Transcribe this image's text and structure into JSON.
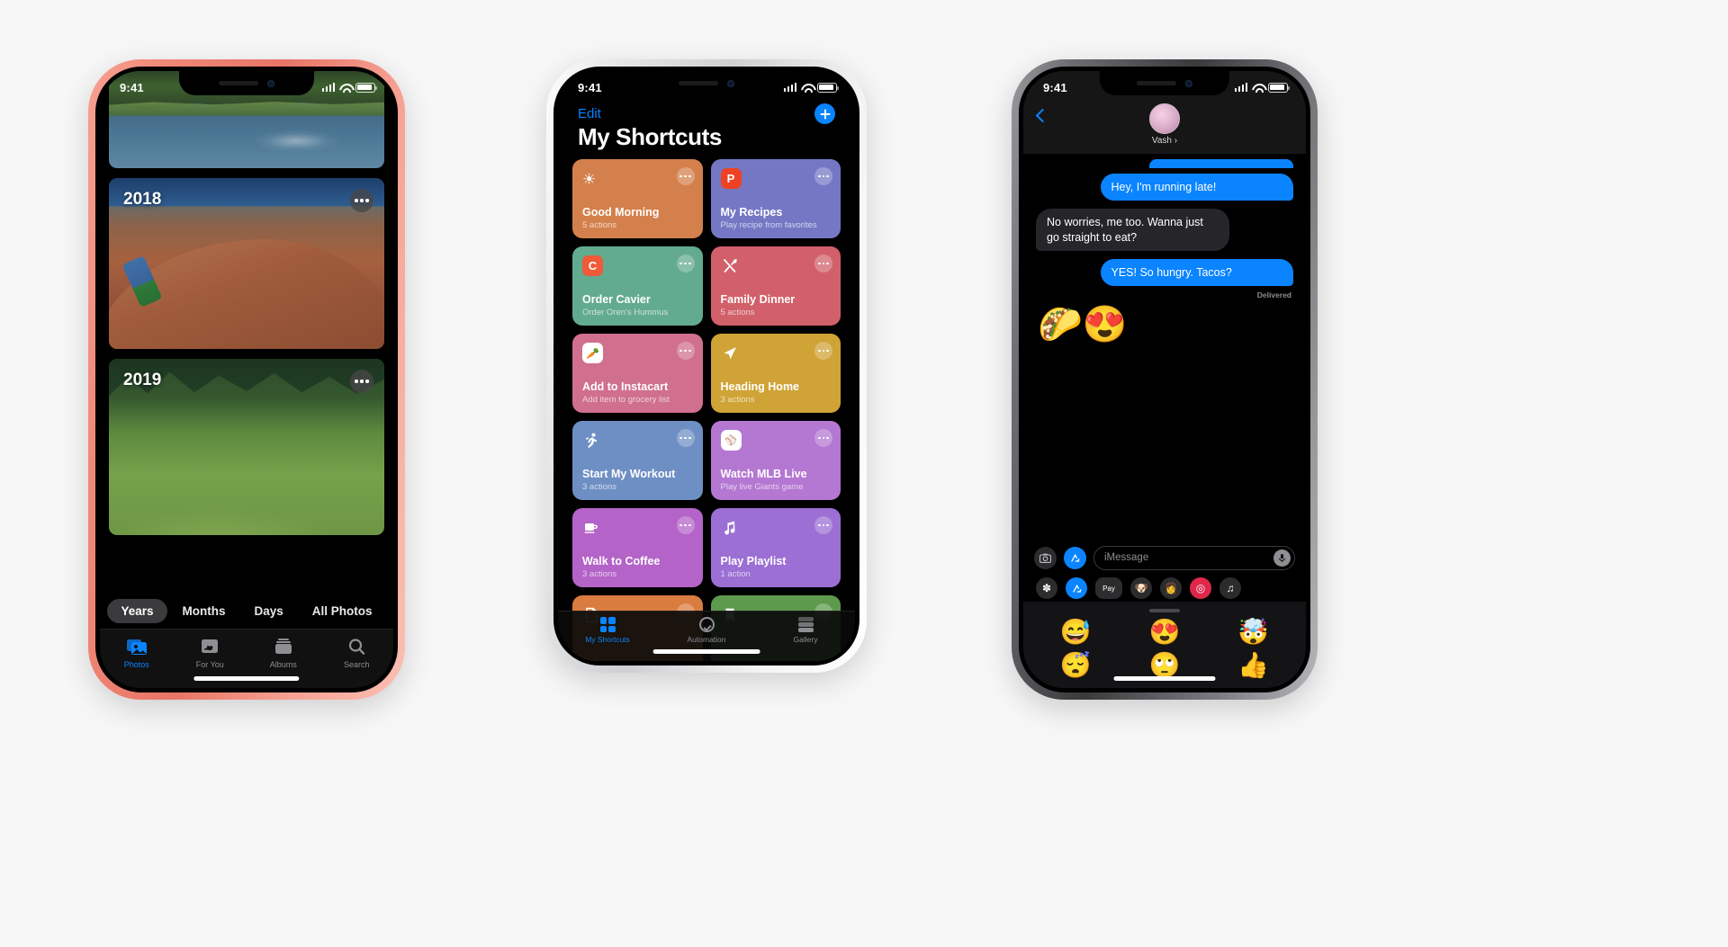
{
  "phones": {
    "photos": {
      "device_name": "iPhone (coral)",
      "status": {
        "time": "9:41",
        "signal_icon": "cellular-bars-icon",
        "wifi_icon": "wifi-icon",
        "battery_icon": "battery-icon"
      },
      "cards": [
        {
          "year": "",
          "art": "lake",
          "has_menu": false
        },
        {
          "year": "2018",
          "art": "hill",
          "has_menu": true
        },
        {
          "year": "2019",
          "art": "meadow",
          "has_menu": true
        }
      ],
      "segmented": {
        "options": [
          "Years",
          "Months",
          "Days",
          "All Photos"
        ],
        "selected": "Years"
      },
      "tabs": [
        {
          "label": "Photos",
          "icon": "photos-icon",
          "active": true
        },
        {
          "label": "For You",
          "icon": "heart-card-icon",
          "active": false
        },
        {
          "label": "Albums",
          "icon": "albums-icon",
          "active": false
        },
        {
          "label": "Search",
          "icon": "search-icon",
          "active": false
        }
      ]
    },
    "shortcuts": {
      "device_name": "iPhone (white)",
      "status": {
        "time": "9:41"
      },
      "nav": {
        "edit_label": "Edit",
        "add_icon": "plus-icon"
      },
      "title": "My Shortcuts",
      "cards": [
        {
          "name": "Good Morning",
          "subtitle": "5 actions",
          "color": "#d4804c",
          "glyph": "☀",
          "glyph_kind": "sun-icon"
        },
        {
          "name": "My Recipes",
          "subtitle": "Play recipe from favorites",
          "color": "#7478c4",
          "glyph": "P",
          "glyph_kind": "paprika-app-icon",
          "chip_color": "#ef4123"
        },
        {
          "name": "Order Cavier",
          "subtitle": "Order Oren's Hummus",
          "color": "#63ab8f",
          "glyph": "C",
          "glyph_kind": "caviar-app-icon",
          "chip_color": "#f05a38"
        },
        {
          "name": "Family Dinner",
          "subtitle": "5 actions",
          "color": "#d2606a",
          "glyph": "⚔",
          "glyph_kind": "fork-knife-icon"
        },
        {
          "name": "Add to Instacart",
          "subtitle": "Add item to grocery list",
          "color": "#d0708e",
          "glyph": "🥕",
          "glyph_kind": "carrot-app-icon",
          "chip_color": "#ffffff"
        },
        {
          "name": "Heading Home",
          "subtitle": "3 actions",
          "color": "#cfa336",
          "glyph": "➤",
          "glyph_kind": "navigation-arrow-icon"
        },
        {
          "name": "Start My Workout",
          "subtitle": "3 actions",
          "color": "#6e8fc4",
          "glyph": "🏃",
          "glyph_kind": "running-person-icon"
        },
        {
          "name": "Watch MLB Live",
          "subtitle": "Play live Giants game",
          "color": "#b477d2",
          "glyph": "⚾",
          "glyph_kind": "mlb-app-icon",
          "chip_color": "#ffffff"
        },
        {
          "name": "Walk to Coffee",
          "subtitle": "3 actions",
          "color": "#b463c8",
          "glyph": "☕",
          "glyph_kind": "coffee-cup-icon"
        },
        {
          "name": "Play Playlist",
          "subtitle": "1 action",
          "color": "#9b6fd4",
          "glyph": "♪",
          "glyph_kind": "music-note-icon"
        },
        {
          "name": "",
          "subtitle": "",
          "color": "#d97c3f",
          "glyph": "📄",
          "glyph_kind": "document-icon"
        },
        {
          "name": "",
          "subtitle": "",
          "color": "#5d9a4e",
          "glyph": "🔖",
          "glyph_kind": "bookmark-icon"
        }
      ],
      "tabs": [
        {
          "label": "My Shortcuts",
          "icon": "grid-icon",
          "active": true
        },
        {
          "label": "Automation",
          "icon": "clock-icon",
          "active": false
        },
        {
          "label": "Gallery",
          "icon": "layers-icon",
          "active": false
        }
      ]
    },
    "messages": {
      "device_name": "iPhone (space gray)",
      "status": {
        "time": "9:41"
      },
      "nav": {
        "back_icon": "chevron-left-icon",
        "contact": "Vash",
        "chevron": "›",
        "avatar": "contact-avatar"
      },
      "thread": [
        {
          "type": "partial-outgoing",
          "text": ""
        },
        {
          "type": "outgoing",
          "text": "Hey, I'm running late!"
        },
        {
          "type": "incoming",
          "text": "No worries, me too. Wanna just go straight to eat?"
        },
        {
          "type": "outgoing",
          "text": "YES! So hungry. Tacos?"
        }
      ],
      "delivered_label": "Delivered",
      "memoji_reply": "🌮😍",
      "input": {
        "placeholder": "iMessage",
        "camera_icon": "camera-icon",
        "appstore_icon": "app-store-icon",
        "mic_icon": "microphone-icon"
      },
      "app_strip": [
        {
          "icon": "photos-app-icon",
          "glyph": "✿",
          "color": "#2c2c2e"
        },
        {
          "icon": "app-store-icon",
          "glyph": "A",
          "color": "#0a84ff"
        },
        {
          "icon": "apple-pay-icon",
          "glyph": "Pay",
          "color": "#2c2c2e"
        },
        {
          "icon": "animoji-dog-icon",
          "glyph": "🐶",
          "color": "#2c2c2e"
        },
        {
          "icon": "memoji-stickers-icon",
          "glyph": "👩",
          "color": "#2c2c2e"
        },
        {
          "icon": "digital-touch-icon",
          "glyph": "◎",
          "color": "#e0274b"
        },
        {
          "icon": "music-app-icon",
          "glyph": "♫",
          "color": "#2c2c2e"
        }
      ],
      "stickers": [
        "😅",
        "😍",
        "🤯",
        "😴",
        "🙄",
        "👍"
      ]
    }
  }
}
